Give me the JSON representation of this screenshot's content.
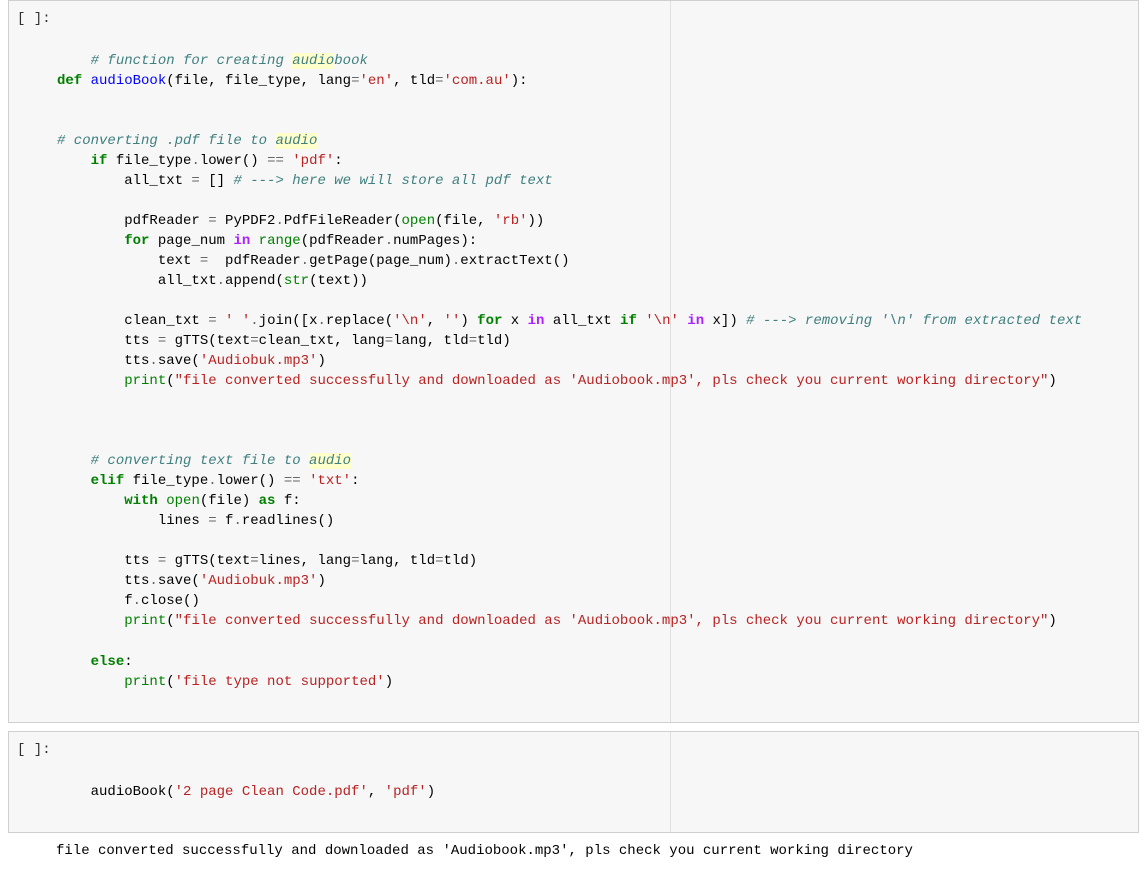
{
  "cells": [
    {
      "prompt": "[ ]:",
      "code_html": "<span class=\"c\"># function for creating <span class=\"hl\">audio</span>book</span>\n<span class=\"k\">def</span> <span class=\"nf\">audioBook</span>(file, file_type, lang<span class=\"o\">=</span><span class=\"s\">'en'</span>, tld<span class=\"o\">=</span><span class=\"s\">'com.au'</span>):\n\n\n<span class=\"c\"># converting .pdf file to <span class=\"hl\">audio</span></span>\n    <span class=\"k\">if</span> file_type<span class=\"o\">.</span>lower() <span class=\"o\">==</span> <span class=\"s\">'pdf'</span>:\n        all_txt <span class=\"o\">=</span> [] <span class=\"c\"># ---&gt; here we will store all pdf text</span>\n\n        pdfReader <span class=\"o\">=</span> PyPDF2<span class=\"o\">.</span>PdfFileReader(<span class=\"nb\">open</span>(file, <span class=\"s\">'rb'</span>))\n        <span class=\"k\">for</span> page_num <span class=\"ow\">in</span> <span class=\"nb\">range</span>(pdfReader<span class=\"o\">.</span>numPages):\n            text <span class=\"o\">=</span>  pdfReader<span class=\"o\">.</span>getPage(page_num)<span class=\"o\">.</span>extractText()\n            all_txt<span class=\"o\">.</span>append(<span class=\"nb\">str</span>(text))\n\n        clean_txt <span class=\"o\">=</span> <span class=\"s\">' '</span><span class=\"o\">.</span>join([x<span class=\"o\">.</span>replace(<span class=\"s\">'</span><span class=\"s\">\\n</span><span class=\"s\">'</span>, <span class=\"s\">''</span>) <span class=\"k\">for</span> x <span class=\"ow\">in</span> all_txt <span class=\"k\">if</span> <span class=\"s\">'</span><span class=\"s\">\\n</span><span class=\"s\">'</span> <span class=\"ow\">in</span> x]) <span class=\"c\"># ---&gt; removing '\\n' from extracted text</span>\n        tts <span class=\"o\">=</span> gTTS(text<span class=\"o\">=</span>clean_txt, lang<span class=\"o\">=</span>lang, tld<span class=\"o\">=</span>tld)\n        tts<span class=\"o\">.</span>save(<span class=\"s\">'Audiobuk.mp3'</span>)\n        <span class=\"nb\">print</span>(<span class=\"s\">\"file converted successfully and downloaded as 'Audiobook.mp3', pls check you current working directory\"</span>)\n\n\n\n    <span class=\"c\"># converting text file to <span class=\"hl\">audio</span></span>\n    <span class=\"k\">elif</span> file_type<span class=\"o\">.</span>lower() <span class=\"o\">==</span> <span class=\"s\">'txt'</span>:\n        <span class=\"k\">with</span> <span class=\"nb\">open</span>(file) <span class=\"k\">as</span> f:\n            lines <span class=\"o\">=</span> f<span class=\"o\">.</span>readlines()\n\n        tts <span class=\"o\">=</span> gTTS(text<span class=\"o\">=</span>lines, lang<span class=\"o\">=</span>lang, tld<span class=\"o\">=</span>tld)\n        tts<span class=\"o\">.</span>save(<span class=\"s\">'Audiobuk.mp3'</span>)\n        f<span class=\"o\">.</span>close()\n        <span class=\"nb\">print</span>(<span class=\"s\">\"file converted successfully and downloaded as 'Audiobook.mp3', pls check you current working directory\"</span>)\n\n    <span class=\"k\">else</span>:\n        <span class=\"nb\">print</span>(<span class=\"s\">'file type not supported'</span>)"
    },
    {
      "prompt": "[ ]:",
      "code_html": "audioBook(<span class=\"s\">'2 page Clean Code.pdf'</span>, <span class=\"s\">'pdf'</span>)"
    }
  ],
  "output": "file converted successfully and downloaded as 'Audiobook.mp3', pls check you current working directory"
}
